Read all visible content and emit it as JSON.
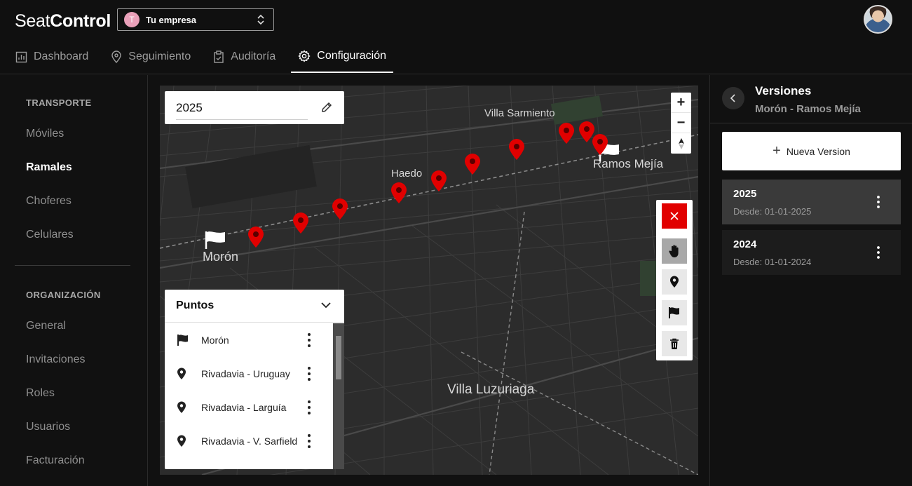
{
  "app": {
    "logo_light": "Seat",
    "logo_bold": "Control"
  },
  "company": {
    "initial": "T",
    "name": "Tu empresa"
  },
  "tabs": [
    {
      "label": "Dashboard",
      "icon": "chart-icon"
    },
    {
      "label": "Seguimiento",
      "icon": "map-pin-icon"
    },
    {
      "label": "Auditoría",
      "icon": "clipboard-icon"
    },
    {
      "label": "Configuración",
      "icon": "gear-icon",
      "active": true
    }
  ],
  "sidebar": {
    "section1": "TRANSPORTE",
    "items1": [
      {
        "label": "Móviles"
      },
      {
        "label": "Ramales",
        "active": true
      },
      {
        "label": "Choferes"
      },
      {
        "label": "Celulares"
      }
    ],
    "section2": "ORGANIZACIÓN",
    "items2": [
      {
        "label": "General"
      },
      {
        "label": "Invitaciones"
      },
      {
        "label": "Roles"
      },
      {
        "label": "Usuarios"
      },
      {
        "label": "Facturación"
      }
    ]
  },
  "editor": {
    "year_value": "2025"
  },
  "map": {
    "labels": {
      "villa_sarmiento": "Villa Sarmiento",
      "haedo": "Haedo",
      "ramos_mejia": "Ramos Mejía",
      "moron": "Morón",
      "villa_luzuriaga": "Villa Luzuriaga"
    },
    "marker_color": "#e10000"
  },
  "points": {
    "title": "Puntos",
    "items": [
      {
        "label": "Morón",
        "icon": "flag-icon"
      },
      {
        "label": "Rivadavia - Uruguay",
        "icon": "pin-icon"
      },
      {
        "label": "Rivadavia - Larguía",
        "icon": "pin-icon"
      },
      {
        "label": "Rivadavia - V. Sarfield",
        "icon": "pin-icon"
      }
    ]
  },
  "versions": {
    "title": "Versiones",
    "subtitle": "Morón - Ramos Mejía",
    "new_button": "Nueva Version",
    "items": [
      {
        "year": "2025",
        "since": "Desde: 01-01-2025",
        "active": true
      },
      {
        "year": "2024",
        "since": "Desde: 01-01-2024"
      }
    ]
  }
}
